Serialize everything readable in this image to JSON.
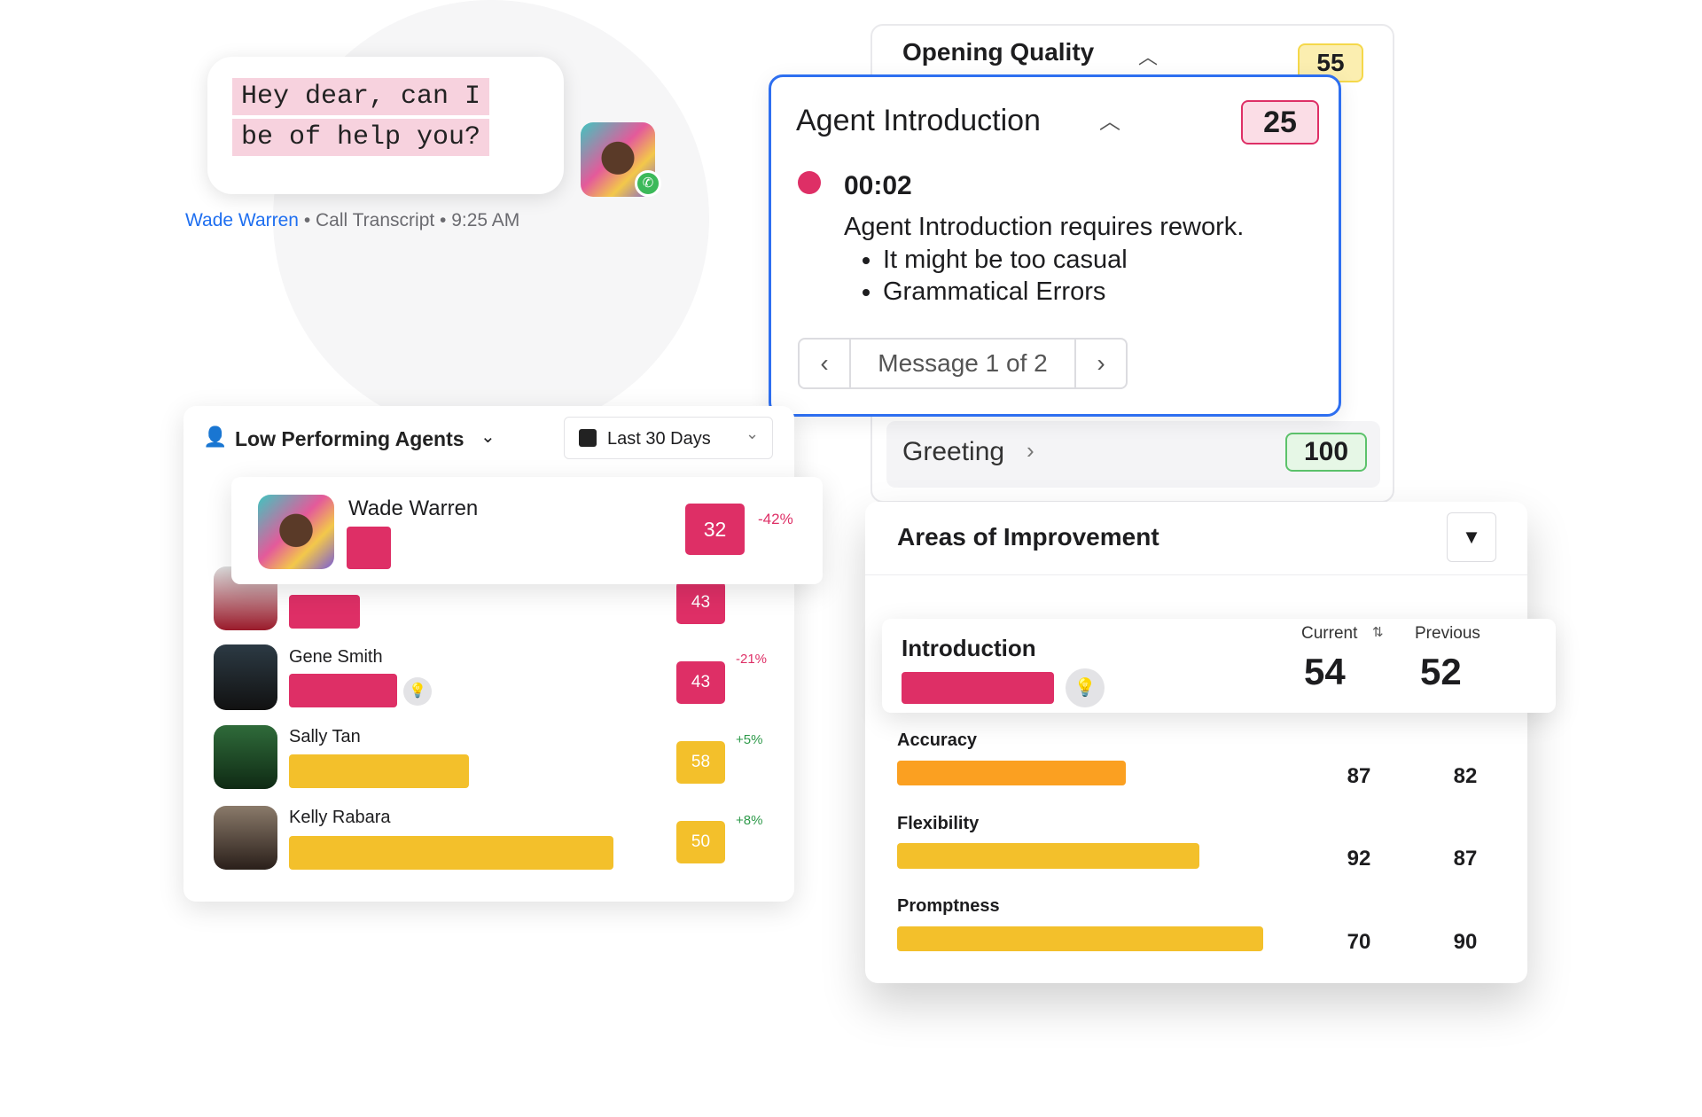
{
  "chat": {
    "lines": [
      "Hey dear, can I",
      "be of help you?"
    ],
    "agent": "Wade Warren",
    "meta": " • Call Transcript • 9:25 AM"
  },
  "opening_quality": {
    "title": "Opening Quality",
    "score": "55",
    "score_color": "#f5d84a"
  },
  "agent_intro": {
    "title": "Agent Introduction",
    "score": "25",
    "timestamp": "00:02",
    "message": "Agent Introduction requires rework.",
    "bullets": [
      "It might be too casual",
      "Grammatical Errors"
    ],
    "pager": "Message 1 of 2"
  },
  "greeting": {
    "title": "Greeting",
    "score": "100"
  },
  "low_performing": {
    "title": "Low Performing Agents",
    "date_filter": "Last 30 Days",
    "highlight": {
      "name": "Wade Warren",
      "score": "32",
      "delta": "-42%"
    },
    "agents": [
      {
        "name": "",
        "score": "43",
        "delta": ""
      },
      {
        "name": "Gene Smith",
        "score": "43",
        "delta": "-21%"
      },
      {
        "name": "Sally Tan",
        "score": "58",
        "delta": "+5%"
      },
      {
        "name": "Kelly Rabara",
        "score": "50",
        "delta": "+8%"
      }
    ]
  },
  "areas": {
    "title": "Areas of Improvement",
    "col_current": "Current",
    "col_previous": "Previous",
    "highlight": {
      "label": "Introduction",
      "current": "54",
      "previous": "52"
    },
    "rows": [
      {
        "label": "Accuracy",
        "current": "87",
        "previous": "82"
      },
      {
        "label": "Flexibility",
        "current": "92",
        "previous": "87"
      },
      {
        "label": "Promptness",
        "current": "70",
        "previous": "90"
      }
    ]
  },
  "colors": {
    "red": "#de2f66",
    "yellow": "#f3c02b",
    "orange": "#fba021",
    "blue": "#2e6ff0",
    "green": "#3cb95a"
  }
}
